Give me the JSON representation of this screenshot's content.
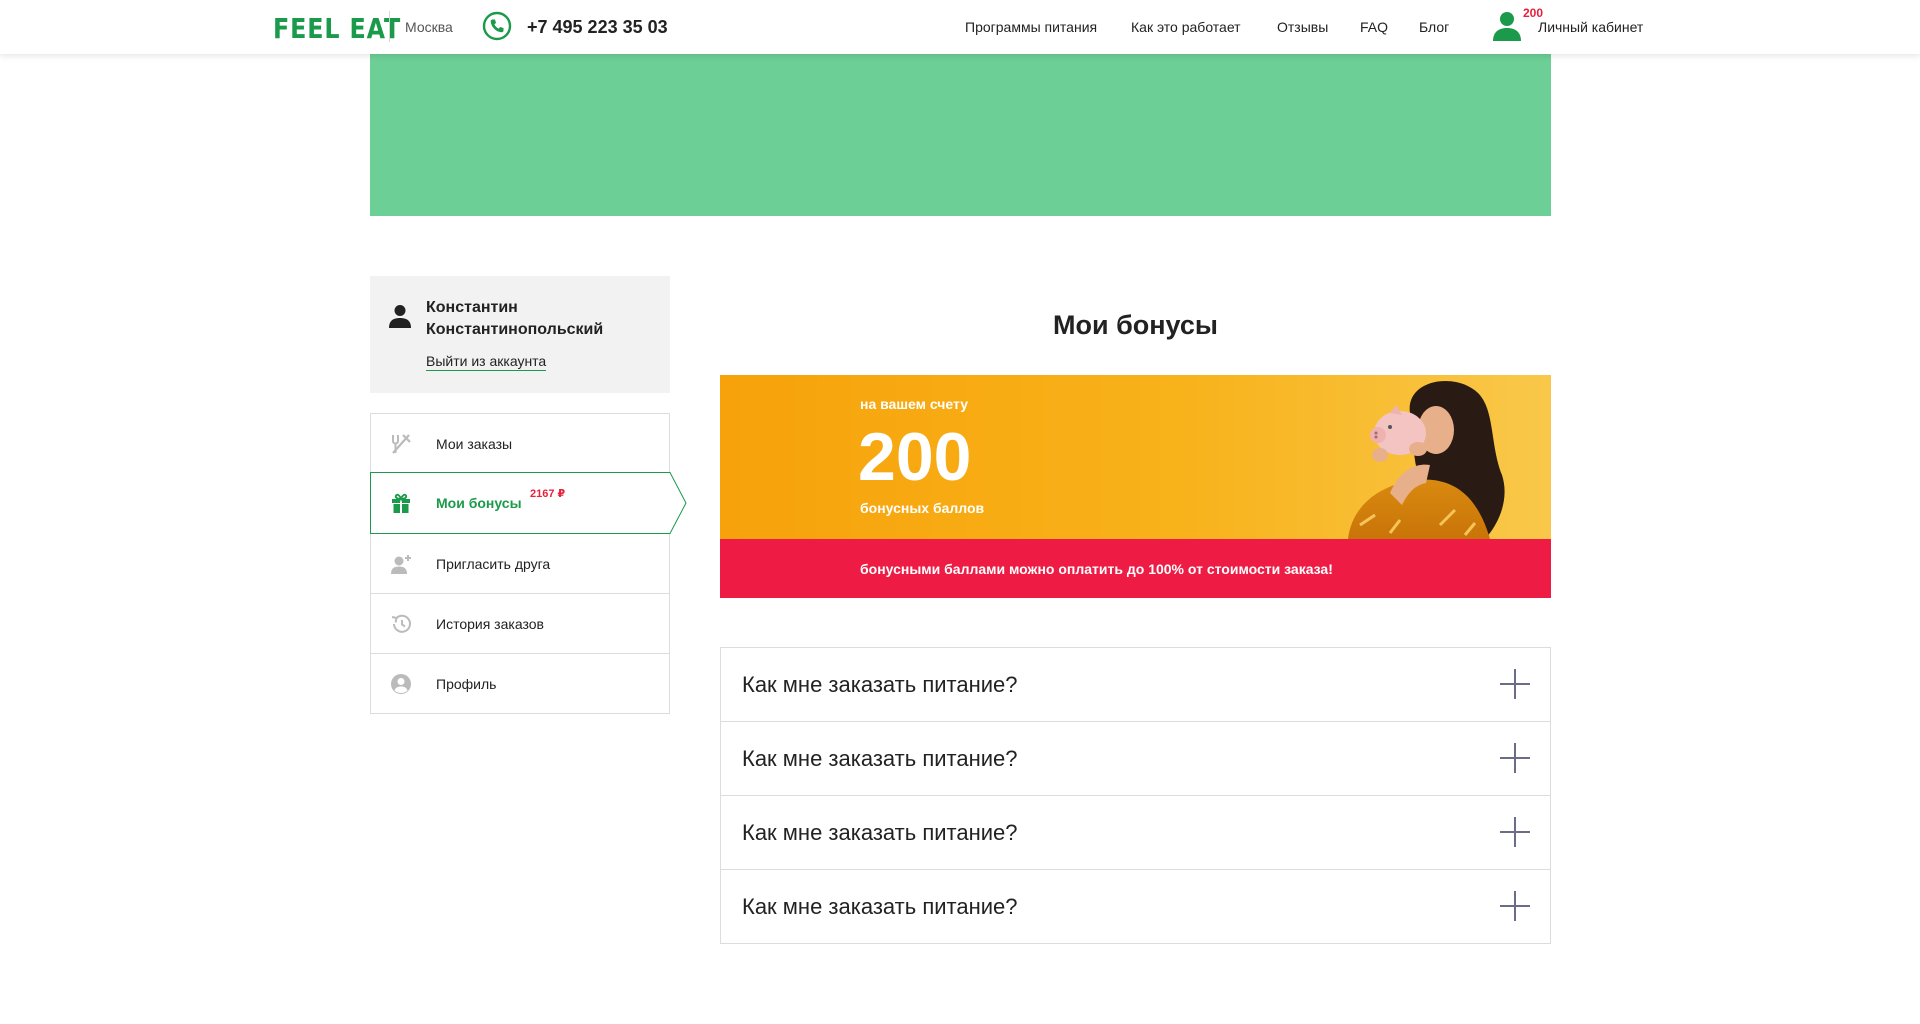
{
  "header": {
    "logo": "FEEL EAT",
    "city": "Москва",
    "phone": "+7 495 223 35 03",
    "nav": [
      "Программы питания",
      "Как это работает",
      "Отзывы",
      "FAQ",
      "Блог"
    ],
    "cabinet_badge": "200",
    "cabinet_label": "Личный кабинет"
  },
  "colors": {
    "brand_green": "#1a9a4a",
    "banner_green": "#6ccf95",
    "bonus_orange": "#f8b21a",
    "alert_red": "#ee1c45"
  },
  "user": {
    "name": "Константин Константинопольский",
    "logout": "Выйти из аккаунта"
  },
  "sidebar": {
    "items": [
      {
        "label": "Мои заказы",
        "icon": "cutlery-icon"
      },
      {
        "label": "Мои бонусы",
        "icon": "gift-icon",
        "badge": "2167 ₽",
        "active": true
      },
      {
        "label": "Пригласить друга",
        "icon": "add-user-icon"
      },
      {
        "label": "История заказов",
        "icon": "history-icon"
      },
      {
        "label": "Профиль",
        "icon": "profile-icon"
      }
    ]
  },
  "main": {
    "title": "Мои бонусы",
    "bonus": {
      "caption": "на вашем счету",
      "value": "200",
      "unit": "бонусных баллов",
      "note": "бонусными баллами можно оплатить до 100% от стоимости заказа!"
    },
    "faq": [
      "Как мне заказать питание?",
      "Как мне заказать питание?",
      "Как мне заказать питание?",
      "Как мне заказать питание?"
    ]
  }
}
